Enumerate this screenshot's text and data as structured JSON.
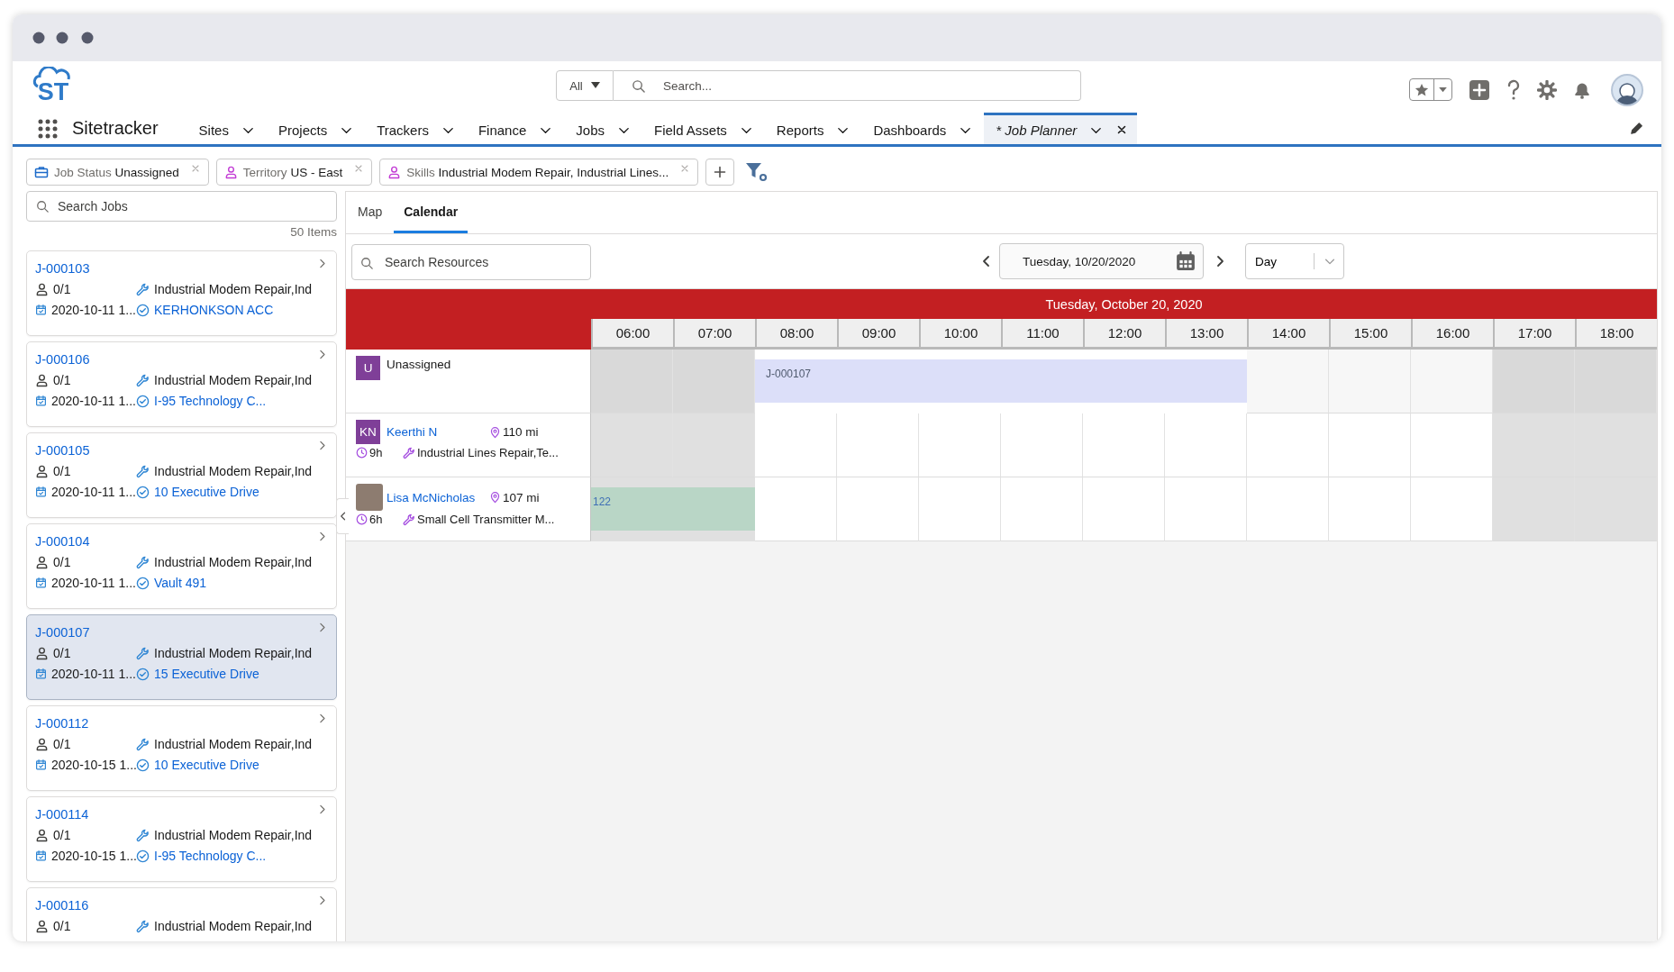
{
  "header": {
    "logo": "ST",
    "search_scope": "All",
    "search_placeholder": "Search...",
    "app_name": "Sitetracker",
    "nav": [
      {
        "label": "Sites",
        "selected": false
      },
      {
        "label": "Projects",
        "selected": false
      },
      {
        "label": "Trackers",
        "selected": false
      },
      {
        "label": "Finance",
        "selected": false
      },
      {
        "label": "Jobs",
        "selected": false
      },
      {
        "label": "Field Assets",
        "selected": false
      },
      {
        "label": "Reports",
        "selected": false
      },
      {
        "label": "Dashboards",
        "selected": false
      },
      {
        "label": "* Job Planner",
        "selected": true
      }
    ]
  },
  "filters": [
    {
      "kind": "status",
      "label": "Job Status",
      "value": "Unassigned"
    },
    {
      "kind": "person",
      "label": "Territory",
      "value": "US - East"
    },
    {
      "kind": "person",
      "label": "Skills",
      "value": "Industrial Modem Repair, Industrial Lines..."
    }
  ],
  "jobs": {
    "search_placeholder": "Search Jobs",
    "count": "50 Items",
    "items": [
      {
        "id": "J-000103",
        "crew": "0/1",
        "skills": "Industrial Modem Repair,Ind",
        "date": "2020-10-11 1...",
        "site": "KERHONKSON ACC",
        "selected": false
      },
      {
        "id": "J-000106",
        "crew": "0/1",
        "skills": "Industrial Modem Repair,Ind",
        "date": "2020-10-11 1...",
        "site": "I-95 Technology C...",
        "selected": false
      },
      {
        "id": "J-000105",
        "crew": "0/1",
        "skills": "Industrial Modem Repair,Ind",
        "date": "2020-10-11 1...",
        "site": "10 Executive Drive",
        "selected": false
      },
      {
        "id": "J-000104",
        "crew": "0/1",
        "skills": "Industrial Modem Repair,Ind",
        "date": "2020-10-11 1...",
        "site": "Vault 491",
        "selected": false
      },
      {
        "id": "J-000107",
        "crew": "0/1",
        "skills": "Industrial Modem Repair,Ind",
        "date": "2020-10-11 1...",
        "site": "15 Executive Drive",
        "selected": true
      },
      {
        "id": "J-000112",
        "crew": "0/1",
        "skills": "Industrial Modem Repair,Ind",
        "date": "2020-10-15 1...",
        "site": "10 Executive Drive",
        "selected": false
      },
      {
        "id": "J-000114",
        "crew": "0/1",
        "skills": "Industrial Modem Repair,Ind",
        "date": "2020-10-15 1...",
        "site": "I-95 Technology C...",
        "selected": false
      },
      {
        "id": "J-000116",
        "crew": "0/1",
        "skills": "Industrial Modem Repair,Ind",
        "selected": false
      }
    ]
  },
  "planner": {
    "tabs": [
      {
        "label": "Map",
        "selected": false
      },
      {
        "label": "Calendar",
        "selected": true
      }
    ],
    "resource_search_placeholder": "Search Resources",
    "date": "Tuesday, 10/20/2020",
    "view": "Day",
    "calendar": {
      "title": "Tuesday, October 20, 2020",
      "hours": [
        {
          "label": "06:00",
          "working": false
        },
        {
          "label": "07:00",
          "working": false
        },
        {
          "label": "08:00",
          "working": true
        },
        {
          "label": "09:00",
          "working": true
        },
        {
          "label": "10:00",
          "working": true
        },
        {
          "label": "11:00",
          "working": true
        },
        {
          "label": "12:00",
          "working": true
        },
        {
          "label": "13:00",
          "working": true
        },
        {
          "label": "14:00",
          "working": true
        },
        {
          "label": "15:00",
          "working": true
        },
        {
          "label": "16:00",
          "working": true
        },
        {
          "label": "17:00",
          "working": false
        },
        {
          "label": "18:00",
          "working": false
        }
      ],
      "resources": [
        {
          "kind": "unassigned",
          "initials": "U",
          "name": "Unassigned",
          "event": {
            "label": "J-000107",
            "color": "#dcdff9"
          },
          "booked": [
            false,
            false,
            true,
            true,
            true,
            true,
            true,
            true,
            false,
            false,
            false,
            false,
            false
          ]
        },
        {
          "kind": "initials",
          "initials": "KN",
          "name": "Keerthi N",
          "distance": "110 mi",
          "hours": "9h",
          "skills": "Industrial Lines Repair,Te..."
        },
        {
          "kind": "photo",
          "name": "Lisa McNicholas",
          "distance": "107 mi",
          "hours": "6h",
          "skills": "Small Cell Transmitter M...",
          "event": {
            "label": "122",
            "color": "#b9d6c6"
          },
          "booked": [
            true,
            true,
            false,
            false,
            false,
            false,
            false,
            false,
            false,
            false,
            false,
            false,
            false
          ]
        }
      ]
    }
  }
}
